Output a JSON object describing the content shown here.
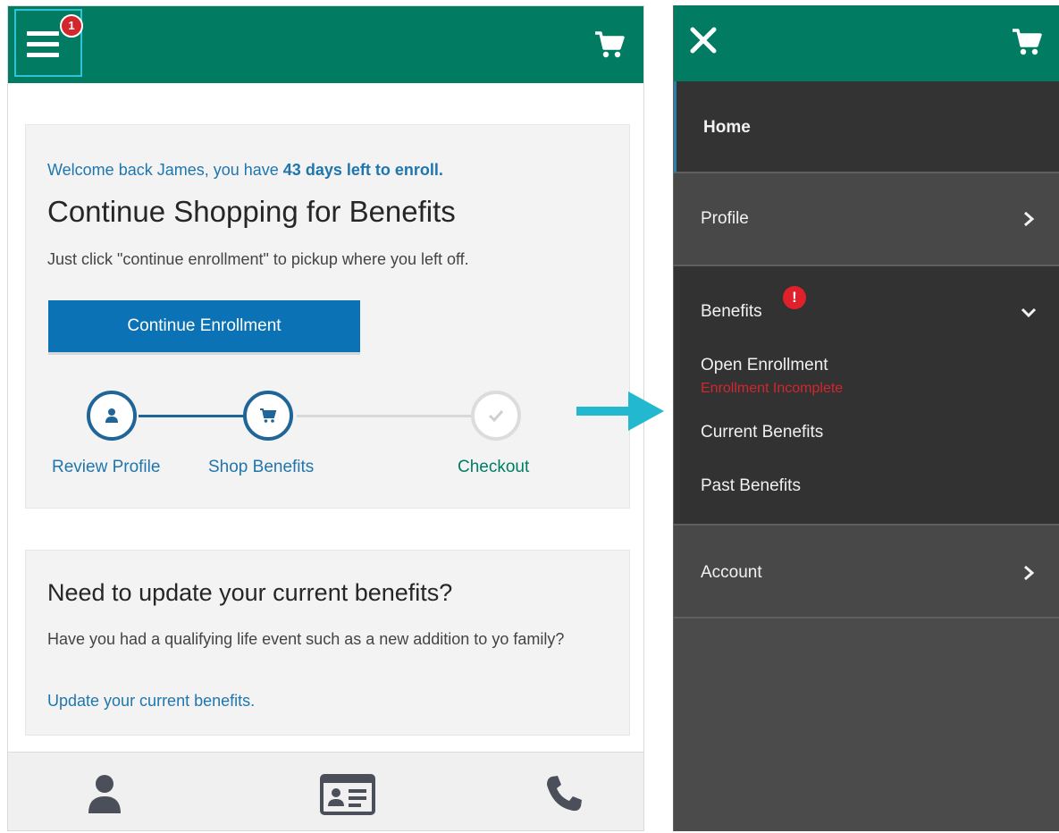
{
  "left_screen": {
    "header": {
      "menu_badge": "1",
      "menu_icon": "hamburger-icon",
      "cart_icon": "cart-icon"
    },
    "welcome": {
      "prefix": "Welcome back James, you have ",
      "days_text": "43 days left to enroll."
    },
    "title": "Continue Shopping for Benefits",
    "subtitle": "Just click \"continue enrollment\" to pickup where you left off.",
    "cta_label": "Continue Enrollment",
    "steps": [
      {
        "label": "Review Profile",
        "icon": "person-icon",
        "state": "complete"
      },
      {
        "label": "Shop Benefits",
        "icon": "cart-icon",
        "state": "current"
      },
      {
        "label": "Checkout",
        "icon": "check-icon",
        "state": "pending"
      }
    ],
    "update_card": {
      "title": "Need to update your current benefits?",
      "text": "Have you had a qualifying life event such as a new addition to yo family?",
      "link": "Update your current benefits."
    },
    "bottom_nav": {
      "icons": [
        "person-icon",
        "id-card-icon",
        "phone-icon"
      ]
    }
  },
  "right_screen": {
    "header": {
      "close_icon": "close-icon",
      "cart_icon": "cart-icon"
    },
    "menu": {
      "home": "Home",
      "profile": "Profile",
      "benefits": "Benefits",
      "benefits_alert": "!",
      "open_enrollment": "Open Enrollment",
      "open_enrollment_status": "Enrollment Incomplete",
      "current_benefits": "Current Benefits",
      "past_benefits": "Past Benefits",
      "account": "Account"
    }
  },
  "colors": {
    "brand_green": "#017c63",
    "link_blue": "#1f76ad",
    "button_blue": "#0b72b5",
    "alert_red": "#d3262d",
    "arrow_cyan": "#22b8cf"
  }
}
